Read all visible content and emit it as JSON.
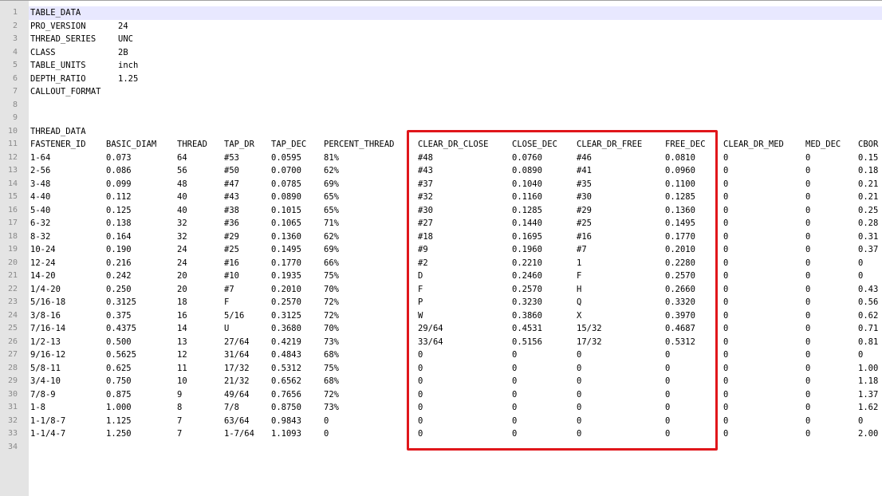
{
  "editor": {
    "highlight_color": "#e0161b",
    "line_numbers": [
      "1",
      "2",
      "3",
      "4",
      "5",
      "6",
      "7",
      "8",
      "9",
      "10",
      "11",
      "12",
      "13",
      "14",
      "15",
      "16",
      "17",
      "18",
      "19",
      "20",
      "21",
      "22",
      "23",
      "24",
      "25",
      "26",
      "27",
      "28",
      "29",
      "30",
      "31",
      "32",
      "33",
      "34"
    ],
    "header_lines": [
      [
        "TABLE_DATA",
        ""
      ],
      [
        "PRO_VERSION",
        "24"
      ],
      [
        "THREAD_SERIES",
        "UNC"
      ],
      [
        "CLASS",
        "2B"
      ],
      [
        "TABLE_UNITS",
        "inch"
      ],
      [
        "DEPTH_RATIO",
        "1.25"
      ],
      [
        "CALLOUT_FORMAT",
        ""
      ],
      [
        "",
        ""
      ],
      [
        "",
        ""
      ],
      [
        "THREAD_DATA",
        ""
      ]
    ],
    "columns": [
      "FASTENER_ID",
      "BASIC_DIAM",
      "THREAD",
      "TAP_DR",
      "TAP_DEC",
      "PERCENT_THREAD",
      "CLEAR_DR_CLOSE",
      "CLOSE_DEC",
      "CLEAR_DR_FREE",
      "FREE_DEC",
      "CLEAR_DR_MED",
      "MED_DEC",
      "CBOR"
    ],
    "rows": [
      [
        "1-64",
        "0.073",
        "64",
        "#53",
        "0.0595",
        "81%",
        "#48",
        "0.0760",
        "#46",
        "0.0810",
        "0",
        "0",
        "0.15"
      ],
      [
        "2-56",
        "0.086",
        "56",
        "#50",
        "0.0700",
        "62%",
        "#43",
        "0.0890",
        "#41",
        "0.0960",
        "0",
        "0",
        "0.18"
      ],
      [
        "3-48",
        "0.099",
        "48",
        "#47",
        "0.0785",
        "69%",
        "#37",
        "0.1040",
        "#35",
        "0.1100",
        "0",
        "0",
        "0.21"
      ],
      [
        "4-40",
        "0.112",
        "40",
        "#43",
        "0.0890",
        "65%",
        "#32",
        "0.1160",
        "#30",
        "0.1285",
        "0",
        "0",
        "0.21"
      ],
      [
        "5-40",
        "0.125",
        "40",
        "#38",
        "0.1015",
        "65%",
        "#30",
        "0.1285",
        "#29",
        "0.1360",
        "0",
        "0",
        "0.25"
      ],
      [
        "6-32",
        "0.138",
        "32",
        "#36",
        "0.1065",
        "71%",
        "#27",
        "0.1440",
        "#25",
        "0.1495",
        "0",
        "0",
        "0.28"
      ],
      [
        "8-32",
        "0.164",
        "32",
        "#29",
        "0.1360",
        "62%",
        "#18",
        "0.1695",
        "#16",
        "0.1770",
        "0",
        "0",
        "0.31"
      ],
      [
        "10-24",
        "0.190",
        "24",
        "#25",
        "0.1495",
        "69%",
        "#9",
        "0.1960",
        "#7",
        "0.2010",
        "0",
        "0",
        "0.37"
      ],
      [
        "12-24",
        "0.216",
        "24",
        "#16",
        "0.1770",
        "66%",
        "#2",
        "0.2210",
        "1",
        "0.2280",
        "0",
        "0",
        "0"
      ],
      [
        "14-20",
        "0.242",
        "20",
        "#10",
        "0.1935",
        "75%",
        "D",
        "0.2460",
        "F",
        "0.2570",
        "0",
        "0",
        "0"
      ],
      [
        "1/4-20",
        "0.250",
        "20",
        "#7",
        "0.2010",
        "70%",
        "F",
        "0.2570",
        "H",
        "0.2660",
        "0",
        "0",
        "0.43"
      ],
      [
        "5/16-18",
        "0.3125",
        "18",
        "F",
        "0.2570",
        "72%",
        "P",
        "0.3230",
        "Q",
        "0.3320",
        "0",
        "0",
        "0.56"
      ],
      [
        "3/8-16",
        "0.375",
        "16",
        "5/16",
        "0.3125",
        "72%",
        "W",
        "0.3860",
        "X",
        "0.3970",
        "0",
        "0",
        "0.62"
      ],
      [
        "7/16-14",
        "0.4375",
        "14",
        "U",
        "0.3680",
        "70%",
        "29/64",
        "0.4531",
        "15/32",
        "0.4687",
        "0",
        "0",
        "0.71"
      ],
      [
        "1/2-13",
        "0.500",
        "13",
        "27/64",
        "0.4219",
        "73%",
        "33/64",
        "0.5156",
        "17/32",
        "0.5312",
        "0",
        "0",
        "0.81"
      ],
      [
        "9/16-12",
        "0.5625",
        "12",
        "31/64",
        "0.4843",
        "68%",
        "0",
        "0",
        "0",
        "0",
        "0",
        "0",
        "0"
      ],
      [
        "5/8-11",
        "0.625",
        "11",
        "17/32",
        "0.5312",
        "75%",
        "0",
        "0",
        "0",
        "0",
        "0",
        "0",
        "1.00"
      ],
      [
        "3/4-10",
        "0.750",
        "10",
        "21/32",
        "0.6562",
        "68%",
        "0",
        "0",
        "0",
        "0",
        "0",
        "0",
        "1.18"
      ],
      [
        "7/8-9",
        "0.875",
        "9",
        "49/64",
        "0.7656",
        "72%",
        "0",
        "0",
        "0",
        "0",
        "0",
        "0",
        "1.37"
      ],
      [
        "1-8",
        "1.000",
        "8",
        "7/8",
        "0.8750",
        "73%",
        "0",
        "0",
        "0",
        "0",
        "0",
        "0",
        "1.62"
      ],
      [
        "1-1/8-7",
        "1.125",
        "7",
        "63/64",
        "0.9843",
        "0",
        "0",
        "0",
        "0",
        "0",
        "0",
        "0",
        "0"
      ],
      [
        "1-1/4-7",
        "1.250",
        "7",
        "1-7/64",
        "1.1093",
        "0",
        "0",
        "0",
        "0",
        "0",
        "0",
        "0",
        "2.00"
      ]
    ]
  }
}
